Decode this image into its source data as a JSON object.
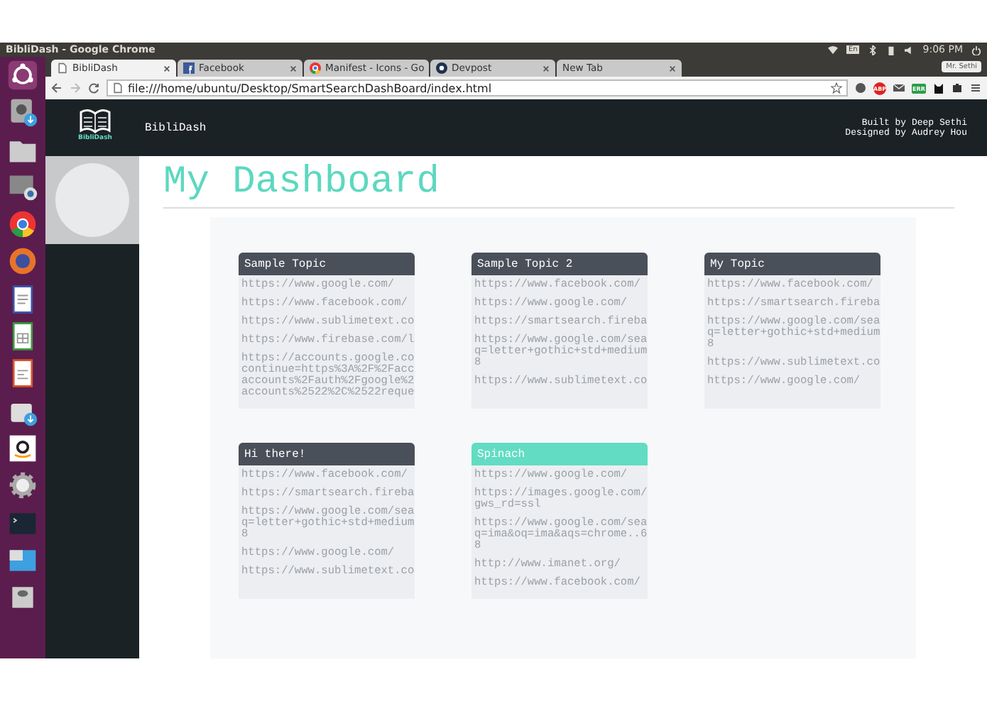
{
  "top_bar": {
    "title": "BibliDash - Google Chrome",
    "keyboard": "En",
    "time": "9:06 PM"
  },
  "launcher": {
    "items": [
      {
        "kind": "ubuntu"
      },
      {
        "kind": "installer"
      },
      {
        "kind": "files"
      },
      {
        "kind": "screenshot"
      },
      {
        "kind": "chrome"
      },
      {
        "kind": "firefox"
      },
      {
        "kind": "writer"
      },
      {
        "kind": "calc"
      },
      {
        "kind": "impress"
      },
      {
        "kind": "store"
      },
      {
        "kind": "amazon"
      },
      {
        "kind": "settings"
      },
      {
        "kind": "terminal"
      },
      {
        "kind": "workspaces"
      },
      {
        "kind": "drive"
      }
    ]
  },
  "tabs": [
    {
      "label": "BibliDash",
      "selected": true,
      "kind": "page"
    },
    {
      "label": "Facebook",
      "selected": false,
      "kind": "facebook"
    },
    {
      "label": "Manifest - Icons - Go",
      "selected": false,
      "kind": "chrome"
    },
    {
      "label": "Devpost",
      "selected": false,
      "kind": "devpost"
    },
    {
      "label": "New Tab",
      "selected": false,
      "kind": "none"
    }
  ],
  "profile": "Mr. Sethi",
  "address": "file:///home/ubuntu/Desktop/SmartSearchDashBoard/index.html",
  "extension_badges": [
    "ABP",
    "ERR"
  ],
  "header": {
    "logo_text": "BibliDash",
    "brand": "BibliDash",
    "credits": [
      "Built by Deep Sethi",
      "Designed by Audrey Hou"
    ]
  },
  "dashboard": {
    "title": "My Dashboard",
    "topics": [
      {
        "title": "Sample Topic",
        "color": "#4a5059",
        "links": [
          "https://www.google.com/",
          "https://www.facebook.com/",
          "https://www.sublimetext.co",
          "https://www.firebase.com/l",
          "https://accounts.google.co\ncontinue=https%3A%2F%2Facc\naccounts%2Fauth%2Fgoogle%2\naccounts%2522%2C%2522reque"
        ]
      },
      {
        "title": "Sample Topic 2",
        "color": "#4a5059",
        "links": [
          "https://www.facebook.com/",
          "https://www.google.com/",
          "https://smartsearch.fireba",
          "https://www.google.com/sea\nq=letter+gothic+std+medium\n8",
          "https://www.sublimetext.co"
        ]
      },
      {
        "title": "My Topic",
        "color": "#4a5059",
        "links": [
          "https://www.facebook.com/",
          "https://smartsearch.fireba",
          "https://www.google.com/sea\nq=letter+gothic+std+medium\n8",
          "https://www.sublimetext.co",
          "https://www.google.com/"
        ]
      },
      {
        "title": "Hi there!",
        "color": "#4a5059",
        "links": [
          "https://www.facebook.com/",
          "https://smartsearch.fireba",
          "https://www.google.com/sea\nq=letter+gothic+std+medium\n8",
          "https://www.google.com/",
          "https://www.sublimetext.co"
        ]
      },
      {
        "title": "Spinach",
        "color": "#62dcc3",
        "links": [
          "https://www.google.com/",
          "https://images.google.com/\ngws_rd=ssl",
          "https://www.google.com/sea\nq=ima&oq=ima&aqs=chrome..6\n8",
          "http://www.imanet.org/",
          "https://www.facebook.com/"
        ]
      }
    ]
  }
}
